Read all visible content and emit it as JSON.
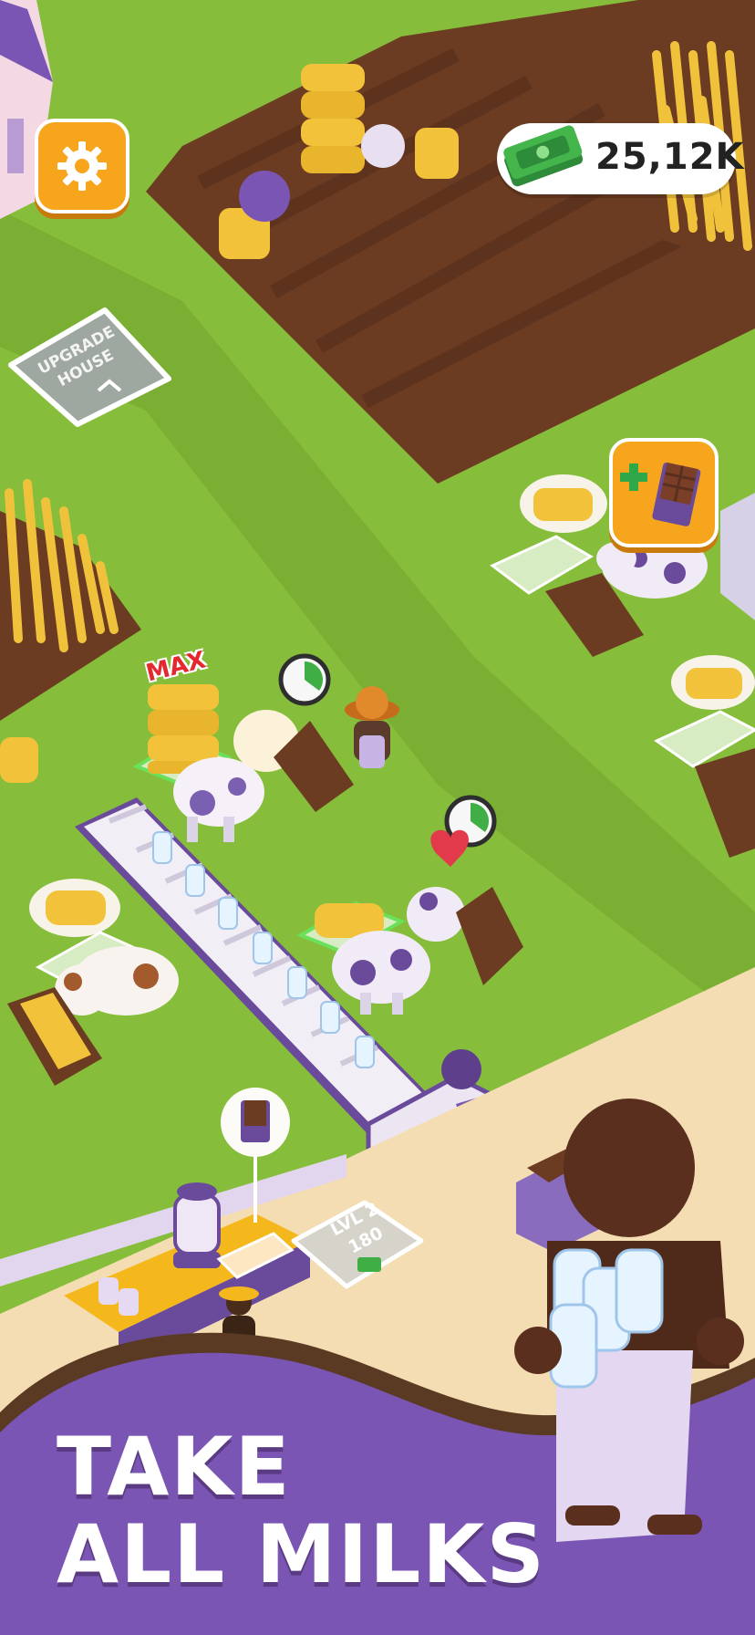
{
  "hud": {
    "money_value": "25,12K",
    "settings_icon": "gear-icon",
    "cash_icon": "cash-stack-icon"
  },
  "tiles": {
    "upgrade_line1": "UPGRADE",
    "upgrade_line2": "HOUSE",
    "level_label": "LVL 2",
    "level_cost": "180"
  },
  "labels": {
    "max": "MAX"
  },
  "banner": {
    "line1": "TAKE",
    "line2": "ALL MILKS"
  },
  "colors": {
    "grass": "#86bd3a",
    "soil": "#6b3b22",
    "hud_button": "#f7a51c",
    "banner_purple": "#7a55b3",
    "floor": "#f4ddb3"
  }
}
